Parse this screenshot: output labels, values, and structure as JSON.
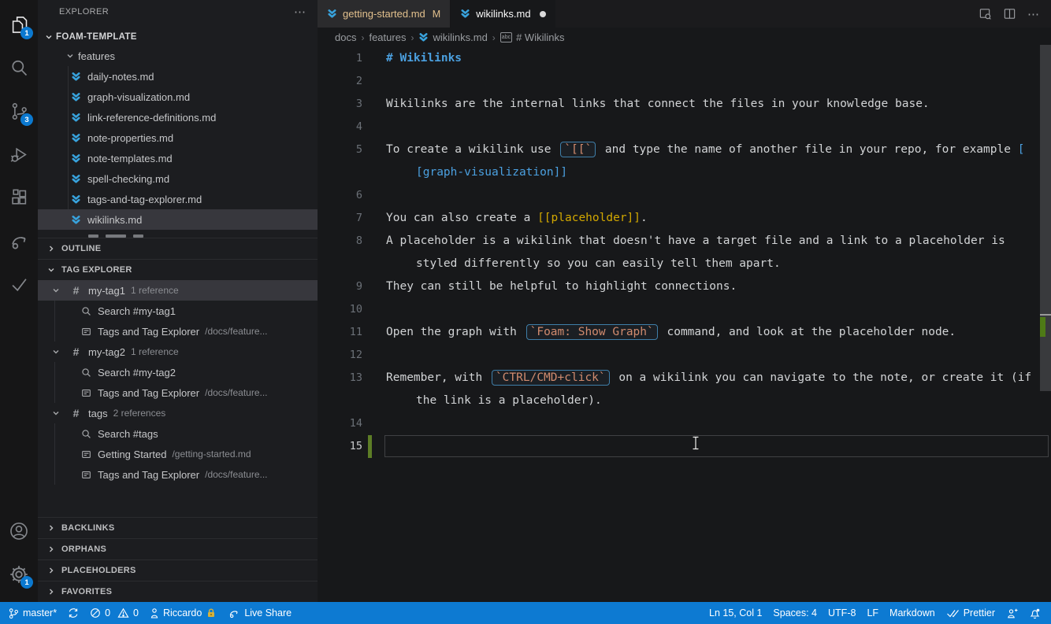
{
  "colors": {
    "status_blue": "#0d7ad2",
    "badge_blue": "#0b79d0",
    "file_icon_blue": "#38a3dd",
    "heading_blue": "#4ba0e0",
    "placeholder_gold": "#d2a800",
    "inline_code_salmon": "#d18b6e",
    "modified_tab_tan": "#e2c08d",
    "git_added_green": "#5d7d26"
  },
  "activity_bar": {
    "items": [
      {
        "id": "explorer",
        "badge": "1",
        "active": true
      },
      {
        "id": "search"
      },
      {
        "id": "source-control",
        "badge": "3"
      },
      {
        "id": "run-debug"
      },
      {
        "id": "extensions"
      },
      {
        "id": "live-share"
      },
      {
        "id": "testing"
      }
    ],
    "bottom": [
      {
        "id": "account"
      },
      {
        "id": "settings",
        "badge": "1"
      }
    ]
  },
  "sidebar": {
    "title": "EXPLORER",
    "more": "⋯",
    "root": "FOAM-TEMPLATE",
    "folder": "features",
    "files": [
      "daily-notes.md",
      "graph-visualization.md",
      "link-reference-definitions.md",
      "note-properties.md",
      "note-templates.md",
      "spell-checking.md",
      "tags-and-tag-explorer.md",
      "wikilinks.md"
    ],
    "selected_file": "wikilinks.md",
    "outline_label": "OUTLINE",
    "tag_explorer_label": "TAG EXPLORER",
    "tags": [
      {
        "name": "my-tag1",
        "count": "1 reference",
        "selected": true,
        "children": [
          {
            "icon": "search",
            "label": "Search #my-tag1"
          },
          {
            "icon": "note",
            "label": "Tags and Tag Explorer",
            "path": "/docs/feature..."
          }
        ]
      },
      {
        "name": "my-tag2",
        "count": "1 reference",
        "children": [
          {
            "icon": "search",
            "label": "Search #my-tag2"
          },
          {
            "icon": "note",
            "label": "Tags and Tag Explorer",
            "path": "/docs/feature..."
          }
        ]
      },
      {
        "name": "tags",
        "count": "2 references",
        "children": [
          {
            "icon": "search",
            "label": "Search #tags"
          },
          {
            "icon": "note",
            "label": "Getting Started",
            "path": "/getting-started.md"
          },
          {
            "icon": "note",
            "label": "Tags and Tag Explorer",
            "path": "/docs/feature..."
          }
        ]
      }
    ],
    "collapsed_sections": [
      "BACKLINKS",
      "ORPHANS",
      "PLACEHOLDERS",
      "FAVORITES"
    ]
  },
  "tabs": [
    {
      "label": "getting-started.md",
      "indicator": "M",
      "state": "modified"
    },
    {
      "label": "wikilinks.md",
      "dirty": true,
      "active": true
    }
  ],
  "breadcrumbs": [
    "docs",
    "features",
    "wikilinks.md",
    "# Wikilinks"
  ],
  "editor": {
    "rows": [
      {
        "n": "1",
        "seg": [
          {
            "c": "h",
            "t": "# Wikilinks"
          }
        ]
      },
      {
        "n": "2",
        "seg": []
      },
      {
        "n": "3",
        "seg": [
          {
            "c": "p",
            "t": "Wikilinks are the internal links that connect the files in your knowledge base."
          }
        ]
      },
      {
        "n": "4",
        "seg": []
      },
      {
        "n": "5",
        "seg": [
          {
            "c": "p",
            "t": "To create a wikilink use "
          },
          {
            "c": "code",
            "t": "`[[`"
          },
          {
            "c": "p",
            "t": " and type the name of another file in your repo, for example "
          },
          {
            "c": "link",
            "t": "["
          }
        ]
      },
      {
        "wrap": true,
        "seg": [
          {
            "c": "link",
            "t": "[graph-visualization]]"
          }
        ]
      },
      {
        "n": "6",
        "seg": []
      },
      {
        "n": "7",
        "seg": [
          {
            "c": "p",
            "t": "You can also create a "
          },
          {
            "c": "ph",
            "t": "[[placeholder]]"
          },
          {
            "c": "p",
            "t": "."
          }
        ]
      },
      {
        "n": "8",
        "seg": [
          {
            "c": "p",
            "t": "A placeholder is a wikilink that doesn't have a target file and a link to a placeholder is"
          }
        ]
      },
      {
        "wrap": true,
        "seg": [
          {
            "c": "p",
            "t": "styled differently so you can easily tell them apart."
          }
        ]
      },
      {
        "n": "9",
        "seg": [
          {
            "c": "p",
            "t": "They can still be helpful to highlight connections."
          }
        ]
      },
      {
        "n": "10",
        "seg": []
      },
      {
        "n": "11",
        "seg": [
          {
            "c": "p",
            "t": "Open the graph with "
          },
          {
            "c": "code",
            "t": "`Foam: Show Graph`"
          },
          {
            "c": "p",
            "t": " command, and look at the placeholder node."
          }
        ]
      },
      {
        "n": "12",
        "seg": []
      },
      {
        "n": "13",
        "seg": [
          {
            "c": "p",
            "t": "Remember, with "
          },
          {
            "c": "code",
            "t": "`CTRL/CMD+click`"
          },
          {
            "c": "p",
            "t": " on a wikilink you can navigate to the note, or create it (if"
          }
        ]
      },
      {
        "wrap": true,
        "seg": [
          {
            "c": "p",
            "t": "the link is a placeholder)."
          }
        ]
      },
      {
        "n": "14",
        "seg": []
      },
      {
        "n": "15",
        "current": true,
        "seg": []
      }
    ]
  },
  "status_bar": {
    "left": {
      "branch": "master*",
      "errors": "0",
      "warnings": "0",
      "user": "Riccardo",
      "live_share": "Live Share"
    },
    "right": {
      "cursor": "Ln 15, Col 1",
      "indent": "Spaces: 4",
      "encoding": "UTF-8",
      "eol": "LF",
      "language": "Markdown",
      "formatter": "Prettier"
    }
  }
}
